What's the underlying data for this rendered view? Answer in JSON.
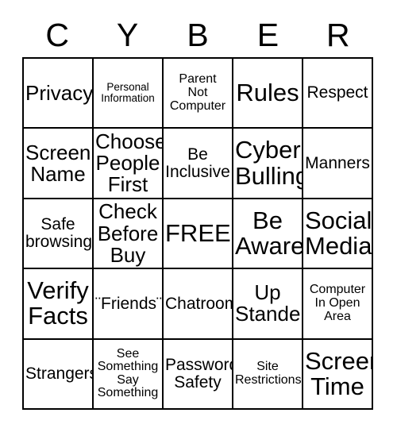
{
  "card": {
    "header_letters": [
      "C",
      "Y",
      "B",
      "E",
      "R"
    ],
    "rows": [
      [
        {
          "text": "Privacy",
          "size": "lg"
        },
        {
          "text": "Personal\nInformation",
          "size": "xs"
        },
        {
          "text": "Parent\nNot\nComputer",
          "size": "sm"
        },
        {
          "text": "Rules",
          "size": "xl"
        },
        {
          "text": "Respect",
          "size": "md"
        }
      ],
      [
        {
          "text": "Screen\nName",
          "size": "lg"
        },
        {
          "text": "Choose\nPeople\nFirst",
          "size": "lg"
        },
        {
          "text": "Be\nInclusive",
          "size": "md"
        },
        {
          "text": "Cyber\nBulling",
          "size": "xl"
        },
        {
          "text": "Manners",
          "size": "md"
        }
      ],
      [
        {
          "text": "Safe\nbrowsing",
          "size": "md"
        },
        {
          "text": "Check\nBefore\nBuy",
          "size": "lg"
        },
        {
          "text": "FREE",
          "size": "xl"
        },
        {
          "text": "Be\nAware",
          "size": "xl"
        },
        {
          "text": "Social\nMedia",
          "size": "xl"
        }
      ],
      [
        {
          "text": "Verify\nFacts",
          "size": "xl"
        },
        {
          "text": "¨Friends¨",
          "size": "md"
        },
        {
          "text": "Chatroom",
          "size": "md"
        },
        {
          "text": "Up\nStander",
          "size": "lg"
        },
        {
          "text": "Computer\nIn Open\nArea",
          "size": "sm"
        }
      ],
      [
        {
          "text": "Strangers",
          "size": "md"
        },
        {
          "text": "See\nSomething\nSay\nSomething",
          "size": "sm"
        },
        {
          "text": "Password\nSafety",
          "size": "md"
        },
        {
          "text": "Site\nRestrictions",
          "size": "sm"
        },
        {
          "text": "Screen\nTime",
          "size": "xl"
        }
      ]
    ]
  }
}
